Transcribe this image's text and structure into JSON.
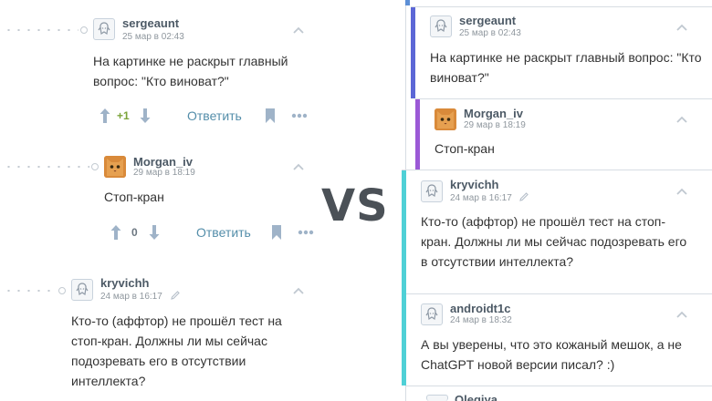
{
  "vs_label": "VS",
  "left": {
    "comments": [
      {
        "username": "sergeaunt",
        "date": "25 мар в 02:43",
        "avatar": "default-avatar",
        "text": "На картинке не раскрыт главный вопрос: \"Кто виноват?\"",
        "score": "+1",
        "score_color": "#7ba33a",
        "reply": "Ответить"
      },
      {
        "username": "Morgan_iv",
        "date": "29 мар в 18:19",
        "avatar": "cat-avatar",
        "text": "Стоп-кран",
        "score": "0",
        "score_color": "#6b7680",
        "reply": "Ответить"
      },
      {
        "username": "kryvichh",
        "date": "24 мар в 16:17",
        "avatar": "default-avatar",
        "text": "Кто-то (аффтор) не прошёл тест на стоп-кран. Должны ли мы сейчас подозревать его в отсутствии интеллекта?"
      }
    ]
  },
  "right": {
    "comments": [
      {
        "username": "sergeaunt",
        "date": "25 мар в 02:43",
        "avatar": "default-avatar",
        "text": "На картинке не раскрыт главный вопрос: \"Кто виноват?\"",
        "thread_color": "#5c67d6"
      },
      {
        "username": "Morgan_iv",
        "date": "29 мар в 18:19",
        "avatar": "cat-avatar",
        "text": "Стоп-кран",
        "thread_color": "#9b59d6"
      },
      {
        "username": "kryvichh",
        "date": "24 мар в 16:17",
        "avatar": "default-avatar",
        "text": "Кто-то (аффтор) не прошёл тест на стоп-кран. Должны ли мы сейчас подозревать его в отсутствии интеллекта?",
        "thread_color": "#4fd0d6"
      },
      {
        "username": "androidt1c",
        "date": "24 мар в 18:32",
        "avatar": "default-avatar",
        "text": "А вы уверены, что это кожаный мешок, а не ChatGPT новой версии писал? :)"
      },
      {
        "username": "Olegiya",
        "avatar": "default-avatar"
      }
    ]
  }
}
